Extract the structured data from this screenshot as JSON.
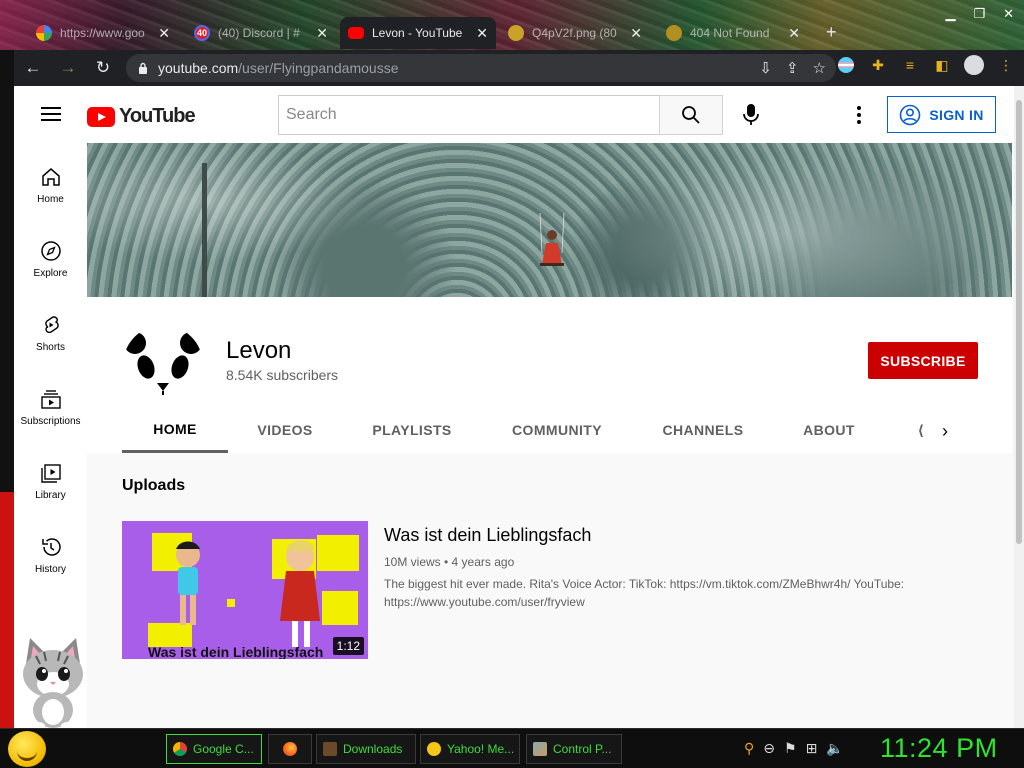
{
  "browser": {
    "tabs": [
      {
        "title": "https://www.goo",
        "favicon": "google-icon",
        "active": false
      },
      {
        "title": "(40) Discord | #",
        "favicon": "discord-icon",
        "badge": "40",
        "active": false
      },
      {
        "title": "Levon - YouTube",
        "favicon": "youtube-icon",
        "active": true
      },
      {
        "title": "Q4pV2f.png (80",
        "favicon": "image-icon",
        "active": false
      },
      {
        "title": "404 Not Found",
        "favicon": "generic-icon",
        "active": false
      }
    ],
    "new_tab": "+",
    "url_host": "youtube.com",
    "url_path": "/user/Flyingpandamousse"
  },
  "youtube": {
    "logo_text": "YouTube",
    "search_placeholder": "Search",
    "sign_in": "SIGN IN",
    "guide": [
      {
        "label": "Home",
        "icon": "home-icon"
      },
      {
        "label": "Explore",
        "icon": "compass-icon"
      },
      {
        "label": "Shorts",
        "icon": "shorts-icon"
      },
      {
        "label": "Subscriptions",
        "icon": "subscriptions-icon"
      },
      {
        "label": "Library",
        "icon": "library-icon"
      },
      {
        "label": "History",
        "icon": "history-icon"
      }
    ],
    "channel": {
      "name": "Levon",
      "subscribers": "8.54K subscribers",
      "subscribe_label": "SUBSCRIBE",
      "tabs": [
        "HOME",
        "VIDEOS",
        "PLAYLISTS",
        "COMMUNITY",
        "CHANNELS",
        "ABOUT"
      ],
      "active_tab": "HOME"
    },
    "uploads": {
      "section_title": "Uploads",
      "video": {
        "title": "Was ist dein Lieblingsfach",
        "views": "10M views",
        "age": "4 years ago",
        "meta": "10M views • 4 years ago",
        "duration": "1:12",
        "thumbnail_caption": "Was ist dein Lieblingsfach",
        "description": "The biggest hit ever made. Rita's Voice Actor: TikTok: https://vm.tiktok.com/ZMeBhwr4h/ YouTube: https://www.youtube.com/user/fryview"
      }
    }
  },
  "taskbar": {
    "items": [
      {
        "label": "Google C...",
        "icon": "chrome-icon",
        "active": true
      },
      {
        "label": "",
        "icon": "firefox-icon",
        "active": false
      },
      {
        "label": "Downloads",
        "icon": "folder-icon",
        "active": false
      },
      {
        "label": "Yahoo! Me...",
        "icon": "yahoo-messenger-icon",
        "active": false
      },
      {
        "label": "Control P...",
        "icon": "control-panel-icon",
        "active": false
      }
    ],
    "clock": "11:24 PM"
  },
  "colors": {
    "youtube_red": "#ff0000",
    "subscribe_red": "#cc0000",
    "link_blue": "#065fd4",
    "taskbar_green": "#2fe22f"
  }
}
